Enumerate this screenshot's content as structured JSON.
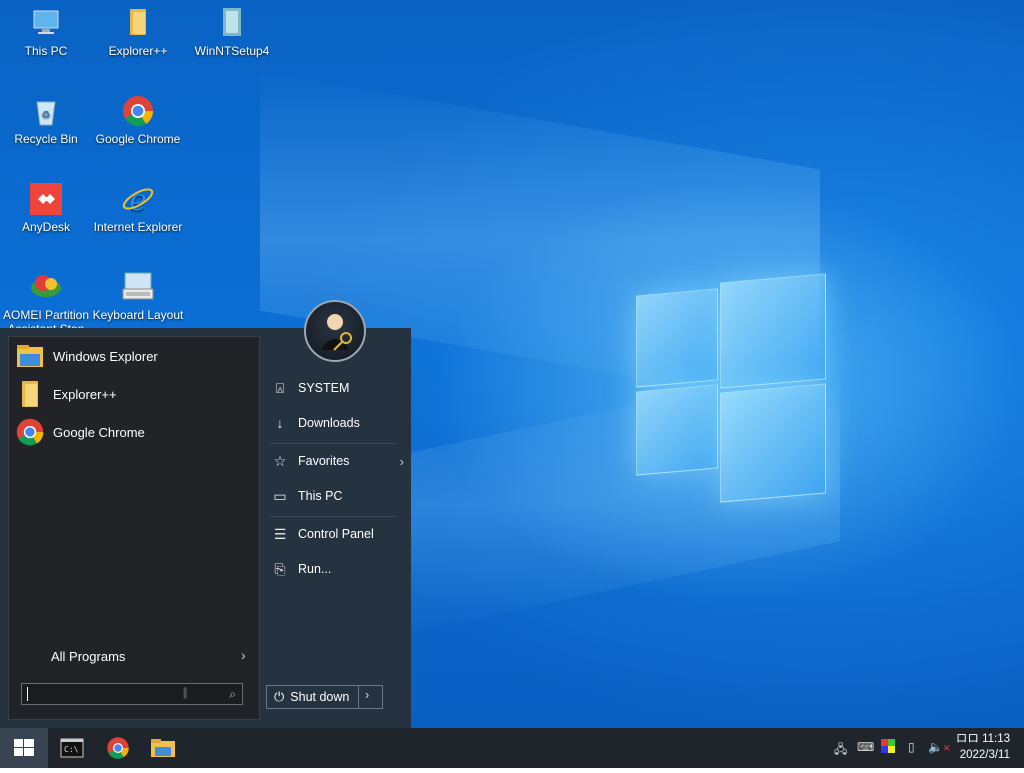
{
  "desktop": {
    "icons": [
      {
        "label": "This PC",
        "icon": "this-pc-icon"
      },
      {
        "label": "Explorer++",
        "icon": "folder-icon"
      },
      {
        "label": "WinNTSetup4",
        "icon": "winntsetup-icon"
      },
      {
        "label": "Recycle Bin",
        "icon": "recycle-bin-icon"
      },
      {
        "label": "Google Chrome",
        "icon": "chrome-icon"
      },
      {
        "label": "AnyDesk",
        "icon": "anydesk-icon"
      },
      {
        "label": "Internet Explorer",
        "icon": "internet-explorer-icon"
      },
      {
        "label": "AOMEI Partition Assistant Stan",
        "icon": "aomei-icon"
      },
      {
        "label": "Keyboard Layout",
        "icon": "keyboard-layout-icon"
      }
    ]
  },
  "start_menu": {
    "pinned": [
      {
        "label": "Windows Explorer",
        "icon": "windows-explorer-icon"
      },
      {
        "label": "Explorer++",
        "icon": "folder-icon"
      },
      {
        "label": "Google Chrome",
        "icon": "chrome-icon"
      }
    ],
    "all_programs": "All Programs",
    "search_value": "",
    "right_items": [
      {
        "label": "SYSTEM",
        "icon": "user-folder-icon"
      },
      {
        "label": "Downloads",
        "icon": "download-icon"
      },
      {
        "label": "Favorites",
        "icon": "star-icon",
        "submenu": true
      },
      {
        "label": "This PC",
        "icon": "monitor-icon"
      },
      {
        "label": "Control Panel",
        "icon": "control-panel-icon"
      },
      {
        "label": "Run...",
        "icon": "run-icon"
      }
    ],
    "shutdown_label": "Shut down"
  },
  "taskbar": {
    "apps": [
      {
        "name": "Command Prompt",
        "icon": "cmd-icon"
      },
      {
        "name": "Google Chrome",
        "icon": "chrome-icon"
      },
      {
        "name": "File Explorer",
        "icon": "file-explorer-icon"
      }
    ],
    "tray_icons": [
      "network-icon",
      "keyboard-icon",
      "color-icon",
      "usb-icon",
      "volume-muted-icon"
    ],
    "clock_time": "ロロ 11:13",
    "clock_date": "2022/3/11"
  },
  "colors": {
    "start_bg": "#253240",
    "taskbar_bg": "#20252c",
    "wallpaper_blue": "#0b6fd6"
  }
}
